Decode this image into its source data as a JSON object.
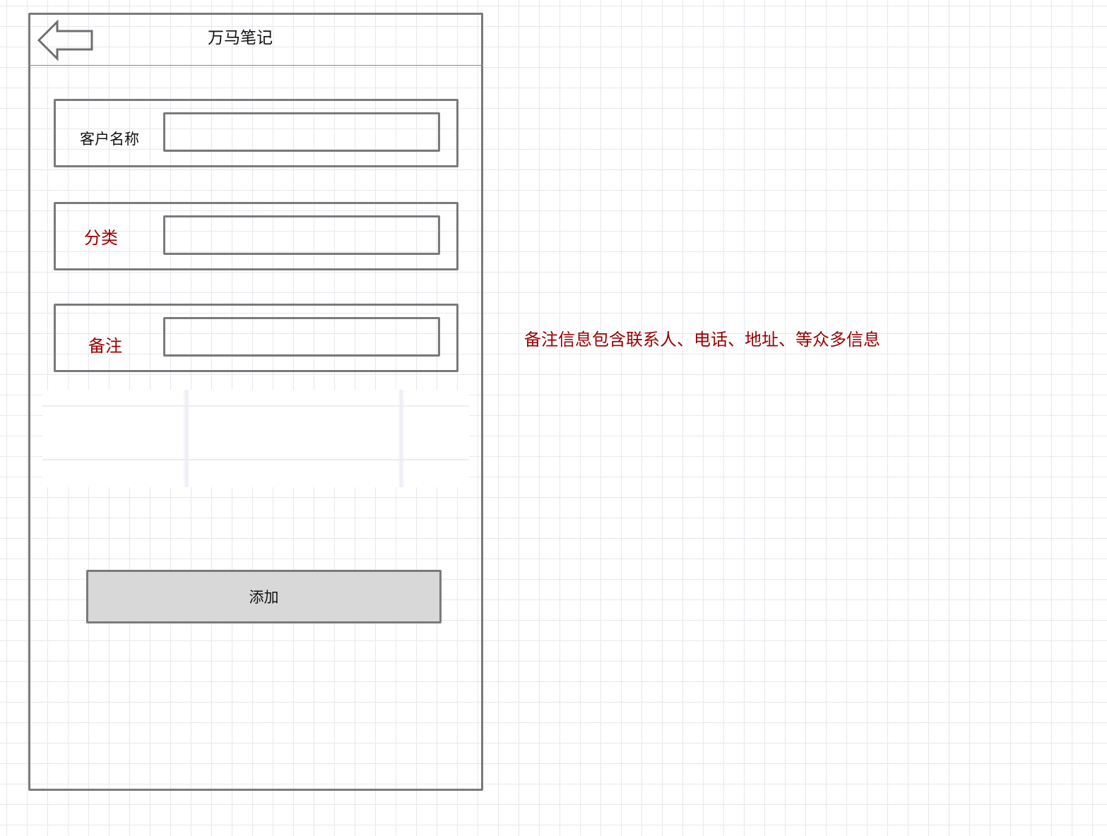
{
  "header": {
    "title": "万马笔记",
    "back_icon": "arrow-left-icon"
  },
  "form": {
    "fields": [
      {
        "label": "客户名称",
        "value": "",
        "label_color": "#111111"
      },
      {
        "label": "分类",
        "value": "",
        "label_color": "#990000"
      },
      {
        "label": "备注",
        "value": "",
        "label_color": "#990000"
      }
    ],
    "submit_label": "添加"
  },
  "annotation": {
    "text": "备注信息包含联系人、电话、地址、等众多信息",
    "color": "#990000"
  },
  "colors": {
    "frame_stroke": "#7a7a7a",
    "button_fill": "#d8d8d8",
    "accent_red": "#990000"
  }
}
